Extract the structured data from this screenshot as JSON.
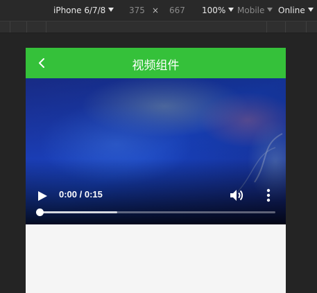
{
  "devtools": {
    "device": "iPhone 6/7/8",
    "width": "375",
    "times": "×",
    "height": "667",
    "zoom": "100%",
    "mode": "Mobile",
    "network": "Online"
  },
  "navbar": {
    "title": "视频组件",
    "back_icon": "chevron-left-icon",
    "color": "#35c13a"
  },
  "video": {
    "time": "0:00 / 0:15",
    "progress": 0,
    "buffered": 0.33,
    "play_icon": "play-icon",
    "volume_icon": "volume-icon",
    "more_icon": "more-vert-icon"
  }
}
